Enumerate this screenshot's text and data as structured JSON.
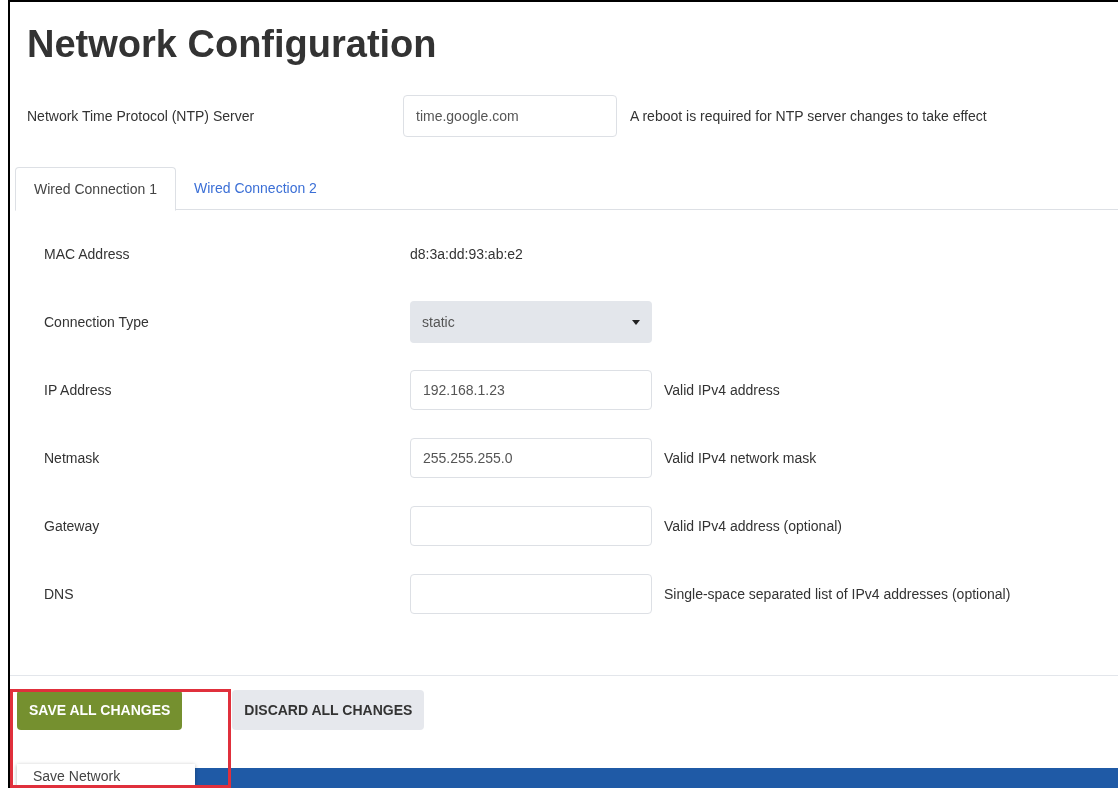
{
  "title": "Network Configuration",
  "ntp": {
    "label": "Network Time Protocol (NTP) Server",
    "value": "time.google.com",
    "note": "A reboot is required for NTP server changes to take effect"
  },
  "tabs": [
    {
      "label": "Wired Connection 1",
      "selected": true
    },
    {
      "label": "Wired Connection 2",
      "selected": false
    }
  ],
  "fields": [
    {
      "kind": "text",
      "label": "MAC Address",
      "value": "d8:3a:dd:93:ab:e2"
    },
    {
      "kind": "select",
      "label": "Connection Type",
      "value": "static"
    },
    {
      "kind": "input",
      "label": "IP Address",
      "value": "192.168.1.23",
      "hint": "Valid IPv4 address"
    },
    {
      "kind": "input",
      "label": "Netmask",
      "value": "255.255.255.0",
      "hint": "Valid IPv4 network mask"
    },
    {
      "kind": "input",
      "label": "Gateway",
      "hint": "Valid IPv4 address (optional)"
    },
    {
      "kind": "input",
      "label": "DNS",
      "hint": "Single-space separated list of IPv4 addresses (optional)"
    }
  ],
  "buttons": [
    {
      "kind": "primary",
      "label": "SAVE ALL CHANGES"
    },
    {
      "kind": "secondary",
      "label": "DISCARD ALL CHANGES"
    }
  ],
  "save_menu": {
    "items": [
      "Save Network"
    ]
  },
  "highlight": {
    "color": "#e0303c"
  }
}
